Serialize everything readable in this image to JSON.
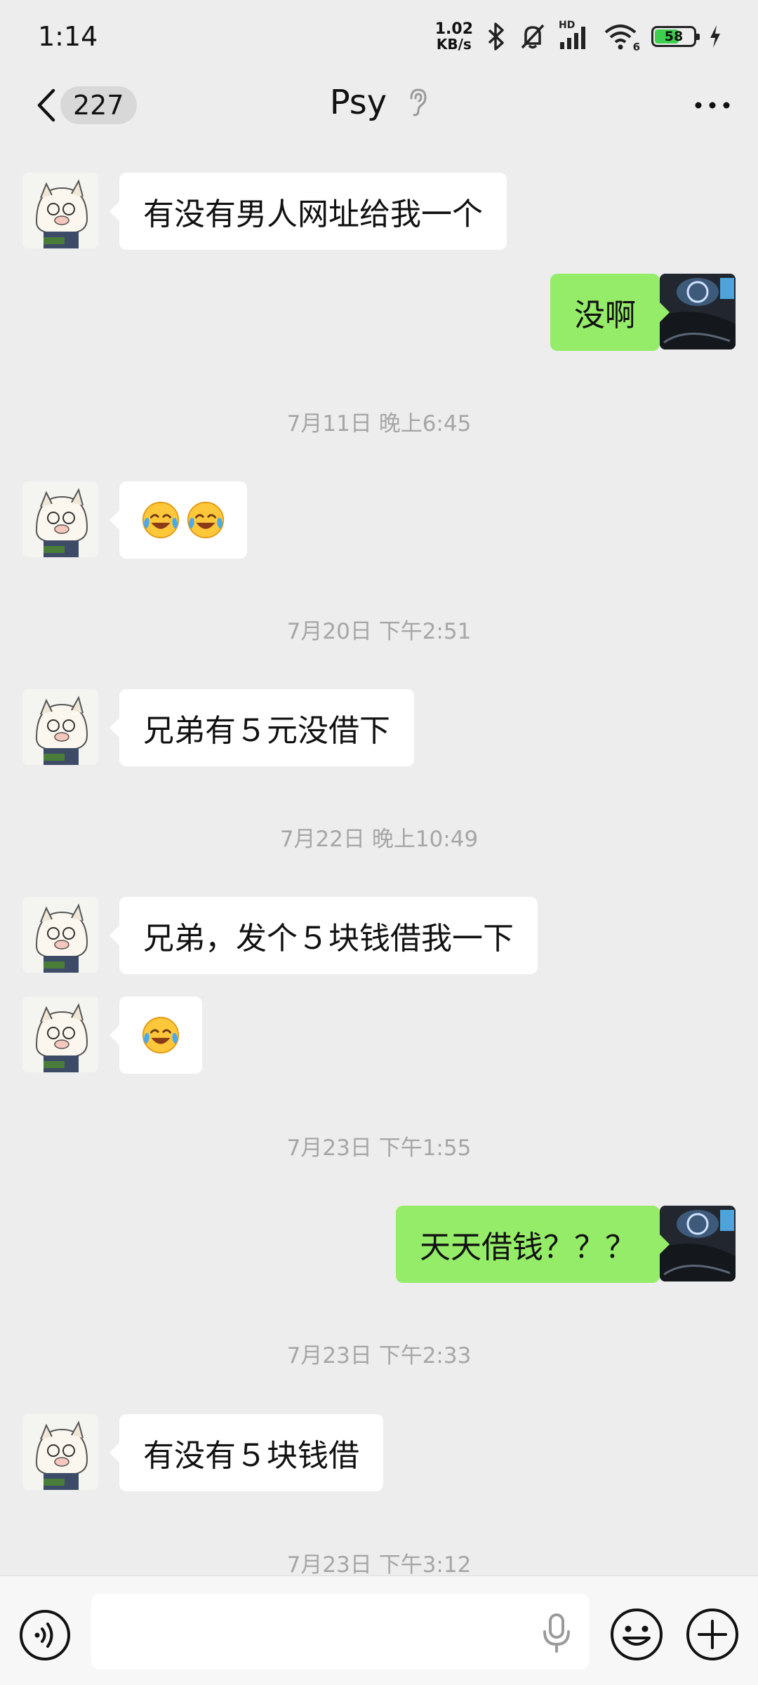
{
  "status": {
    "time": "1:14",
    "net_speed": "1.02",
    "net_unit": "KB/s",
    "signal_label": "HD",
    "wifi_label": "6",
    "battery": "58"
  },
  "header": {
    "unread_count": "227",
    "title": "Psy"
  },
  "messages": [
    {
      "kind": "msg",
      "side": "left",
      "text": "有没有男人网址给我一个"
    },
    {
      "kind": "msg",
      "side": "right",
      "text": "没啊"
    },
    {
      "kind": "time",
      "text": "7月11日 晚上6:45"
    },
    {
      "kind": "emoji",
      "side": "left",
      "emoji": "face-with-tears-of-joy",
      "count": 2
    },
    {
      "kind": "time",
      "text": "7月20日 下午2:51"
    },
    {
      "kind": "msg",
      "side": "left",
      "text": "兄弟有５元没借下"
    },
    {
      "kind": "time",
      "text": "7月22日 晚上10:49"
    },
    {
      "kind": "msg",
      "side": "left",
      "text": "兄弟，发个５块钱借我一下"
    },
    {
      "kind": "emoji",
      "side": "left",
      "emoji": "face-with-tears-of-joy",
      "count": 1
    },
    {
      "kind": "time",
      "text": "7月23日 下午1:55"
    },
    {
      "kind": "msg",
      "side": "right",
      "text": "天天借钱？？？"
    },
    {
      "kind": "time",
      "text": "7月23日 下午2:33"
    },
    {
      "kind": "msg",
      "side": "left",
      "text": "有没有５块钱借"
    },
    {
      "kind": "time",
      "text": "7月23日 下午3:12"
    }
  ],
  "input": {
    "placeholder": ""
  },
  "colors": {
    "background": "#ededed",
    "sent_bubble": "#95ec69",
    "received_bubble": "#ffffff",
    "timestamp_text": "#a6a6a6",
    "battery_fill": "#3ecf4e"
  },
  "icons": {
    "back": "chevron-left-icon",
    "earpiece": "ear-icon",
    "more": "more-dots-icon",
    "voice": "voice-mode-icon",
    "mic": "microphone-icon",
    "emoji": "emoji-icon",
    "plus": "plus-icon"
  }
}
